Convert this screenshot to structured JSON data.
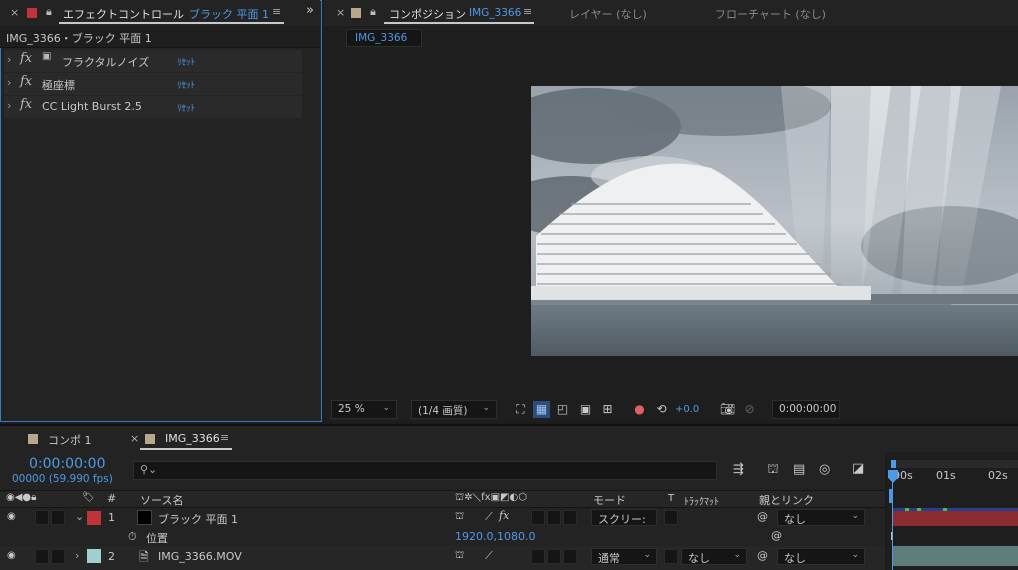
{
  "effect_controls": {
    "close": "×",
    "tab_label": "エフェクトコントロール",
    "tab_layer": "ブラック 平面 1",
    "menu": "≡",
    "collapse": "»",
    "breadcrumb": "IMG_3366・ブラック 平面 1",
    "effects": [
      {
        "fx": "fx",
        "name": "フラクタルノイズ",
        "reset": "ﾘｾｯﾄ"
      },
      {
        "fx": "fx",
        "name": "極座標",
        "reset": "ﾘｾｯﾄ"
      },
      {
        "fx": "fx",
        "name": "CC Light Burst 2.5",
        "reset": "ﾘｾｯﾄ"
      }
    ]
  },
  "composition": {
    "close": "×",
    "tab_label": "コンポジション",
    "tab_comp": "IMG_3366",
    "menu": "≡",
    "layer_tab": "レイヤー (なし)",
    "flowchart_tab": "フローチャート (なし)",
    "comp_chip": "IMG_3366",
    "toolbar": {
      "zoom": "25 %",
      "resolution": "(1/4 画質)",
      "exposure": "+0.0",
      "timecode": "0:00:00:00"
    }
  },
  "timeline": {
    "tabs": [
      {
        "label": "コンポ 1",
        "close": ""
      },
      {
        "label": "IMG_3366",
        "close": "×",
        "menu": "≡"
      }
    ],
    "timecode": "0:00:00:00",
    "frames": "00000 (59.990 fps)",
    "search_placeholder": "",
    "columns": {
      "num": "#",
      "source": "ソース名",
      "mode": "モード",
      "t": "T",
      "trackmatte": "ﾄﾗｯｸﾏｯﾄ",
      "parent": "親とリンク"
    },
    "layers": [
      {
        "num": "1",
        "name": "ブラック 平面 1",
        "mode": "スクリー:",
        "parent": "なし",
        "label_color": "#c0333a"
      },
      {
        "num": "2",
        "name": "IMG_3366.MOV",
        "mode": "通常",
        "trackmatte": "なし",
        "parent": "なし",
        "label_color": "#9fd0cf"
      }
    ],
    "property": {
      "name": "位置",
      "value": "1920.0,1080.0"
    },
    "ruler": [
      "00s",
      "01s",
      "02s"
    ]
  },
  "colors": {
    "accent": "#4f9ae6",
    "panel_focus": "#3a78c8",
    "layer1_bar": "#8b2c30",
    "layer2_bar": "#5e7c79"
  }
}
